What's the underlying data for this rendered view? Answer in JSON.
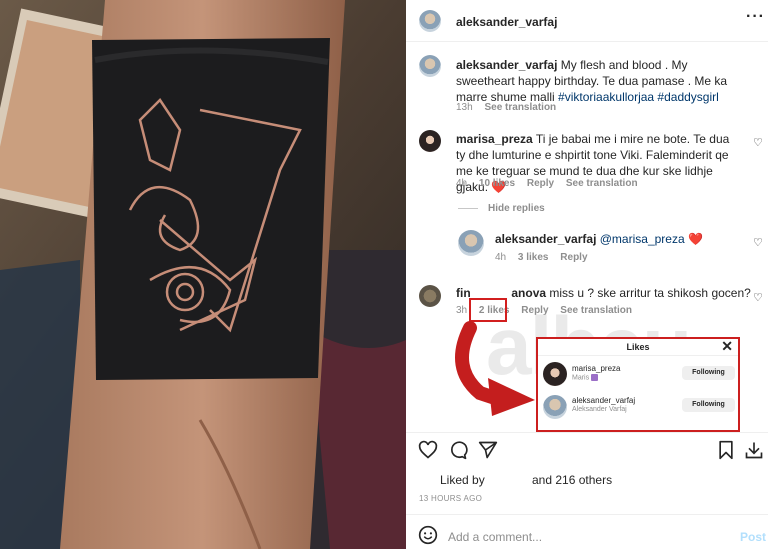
{
  "header": {
    "username": "aleksander_varfaj",
    "more_icon": "ellipsis-icon"
  },
  "caption": {
    "username": "aleksander_varfaj",
    "text": "My flesh and blood . My sweetheart happy birthday. Te dua pamase . Me ka marre shume malli",
    "hashtags": "#viktoriaakullorjaa #daddysgirl",
    "time": "13h",
    "translate": "See translation"
  },
  "comments": [
    {
      "username": "marisa_preza",
      "text": "Ti je babai me i mire ne bote. Te dua ty dhe lumturine e shpirtit tone Viki. Faleminderit qe me ke treguar se mund te dua dhe kur ske lidhje gjaku.",
      "emoji": "❤️",
      "time": "4h",
      "likes": "10 likes",
      "reply": "Reply",
      "translate": "See translation",
      "hide_replies": "Hide replies"
    },
    {
      "username": "aleksander_varfaj",
      "mention": "@marisa_preza",
      "emoji": "❤️",
      "time": "4h",
      "likes": "3 likes",
      "reply": "Reply"
    },
    {
      "username_a": "fin",
      "username_b": "anova",
      "text": "miss u ? ske arritur ta shikosh gocen?",
      "time": "3h",
      "likes": "2 likes",
      "reply": "Reply",
      "translate": "See translation"
    }
  ],
  "likes_modal": {
    "title": "Likes",
    "users": [
      {
        "username": "marisa_preza",
        "name": "Maris",
        "button": "Following"
      },
      {
        "username": "aleksander_varfaj",
        "name": "Aleksander Varfaj",
        "button": "Following"
      }
    ]
  },
  "watermark": "albeu",
  "liked_by": {
    "prefix": "Liked by",
    "suffix": "and 216 others"
  },
  "timestamp": "13 HOURS AGO",
  "add_comment": {
    "placeholder": "Add a comment...",
    "post": "Post"
  },
  "colors": {
    "highlight_red": "#d21f1f",
    "heart": "#e0245e",
    "link": "#00376b"
  }
}
